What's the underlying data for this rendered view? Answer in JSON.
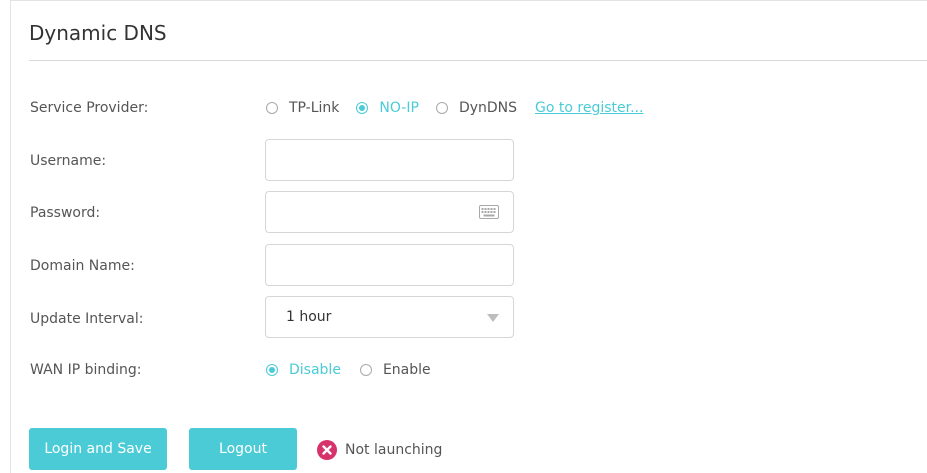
{
  "page": {
    "title": "Dynamic DNS"
  },
  "form": {
    "service_provider": {
      "label": "Service Provider:",
      "options": [
        "TP-Link",
        "NO-IP",
        "DynDNS"
      ],
      "selected": "NO-IP",
      "register_link": "Go to register..."
    },
    "username": {
      "label": "Username:",
      "value": ""
    },
    "password": {
      "label": "Password:",
      "value": "",
      "icon": "keyboard-icon"
    },
    "domain_name": {
      "label": "Domain Name:",
      "value": ""
    },
    "update_interval": {
      "label": "Update Interval:",
      "value": "1 hour"
    },
    "wan_ip_binding": {
      "label": "WAN IP binding:",
      "options": [
        "Disable",
        "Enable"
      ],
      "selected": "Disable"
    }
  },
  "actions": {
    "login_save_label": "Login and Save",
    "logout_label": "Logout"
  },
  "status": {
    "text": "Not launching",
    "icon": "error-x-icon",
    "color": "#d6336c"
  },
  "colors": {
    "accent": "#4acbd6",
    "error": "#d6336c"
  }
}
